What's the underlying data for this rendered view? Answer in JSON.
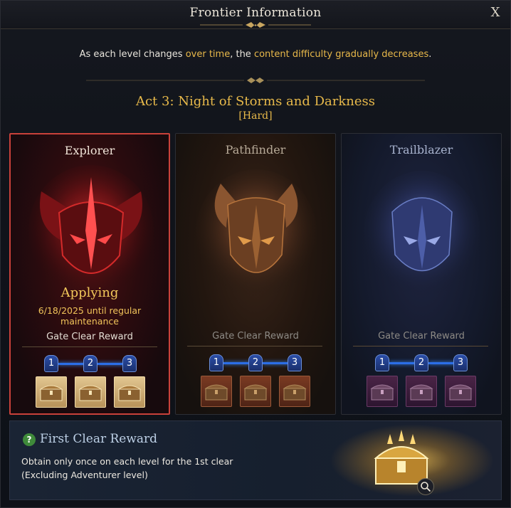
{
  "window": {
    "title": "Frontier Information",
    "close_label": "X"
  },
  "notice": {
    "part1": "As each level changes ",
    "highlight1": "over time",
    "part2": ", the ",
    "highlight2": "content difficulty gradually decreases",
    "part3": "."
  },
  "act": {
    "title": "Act 3: Night of Storms and Darkness",
    "difficulty": "[Hard]"
  },
  "levels": [
    {
      "name": "Explorer",
      "status": "Applying",
      "status_date": "6/18/2025 until regular maintenance",
      "gate_label": "Gate Clear Reward",
      "gates": [
        "1",
        "2",
        "3"
      ]
    },
    {
      "name": "Pathfinder",
      "gate_label": "Gate Clear Reward",
      "gates": [
        "1",
        "2",
        "3"
      ]
    },
    {
      "name": "Trailblazer",
      "gate_label": "Gate Clear Reward",
      "gates": [
        "1",
        "2",
        "3"
      ]
    }
  ],
  "first_clear": {
    "icon": "question-icon",
    "icon_text": "?",
    "title": "First Clear Reward",
    "line1": "Obtain only once on each level for the 1st clear",
    "line2": "(Excluding Adventurer level)"
  },
  "colors": {
    "accent_gold": "#e7b94a",
    "selected_border": "#c9413a",
    "gate_blue": "#2c6ee6"
  }
}
